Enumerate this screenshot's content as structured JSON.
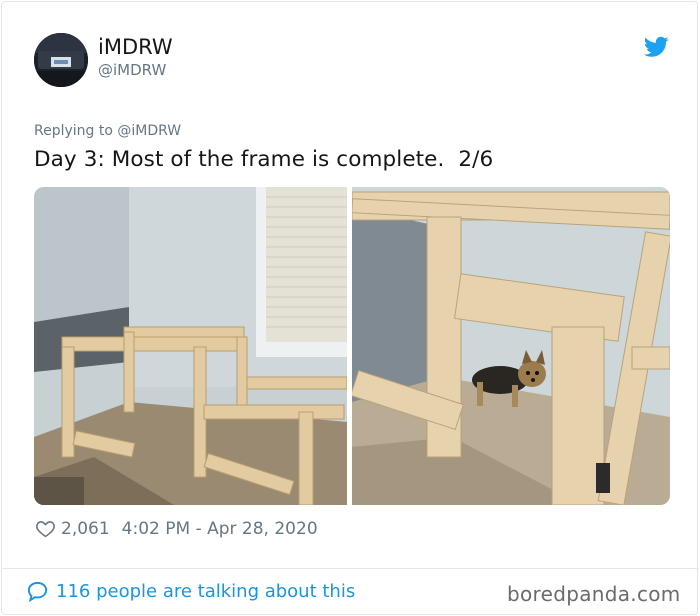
{
  "author": {
    "display_name": "iMDRW",
    "handle": "@iMDRW"
  },
  "tweet": {
    "replying_prefix": "Replying to ",
    "replying_mention": "@iMDRW",
    "text": "Day 3: Most of the frame is complete.  2/6",
    "likes": "2,061",
    "timestamp": "4:02 PM - Apr 28, 2020"
  },
  "footer": {
    "talking": "116 people are talking about this"
  },
  "watermark": "boredpanda.com",
  "colors": {
    "twitter_blue": "#1da1f2",
    "link_blue": "#1b95e0",
    "muted": "#657786"
  },
  "icons": {
    "brand": "twitter-bird-icon",
    "like": "heart-icon",
    "reply": "speech-bubble-icon"
  }
}
